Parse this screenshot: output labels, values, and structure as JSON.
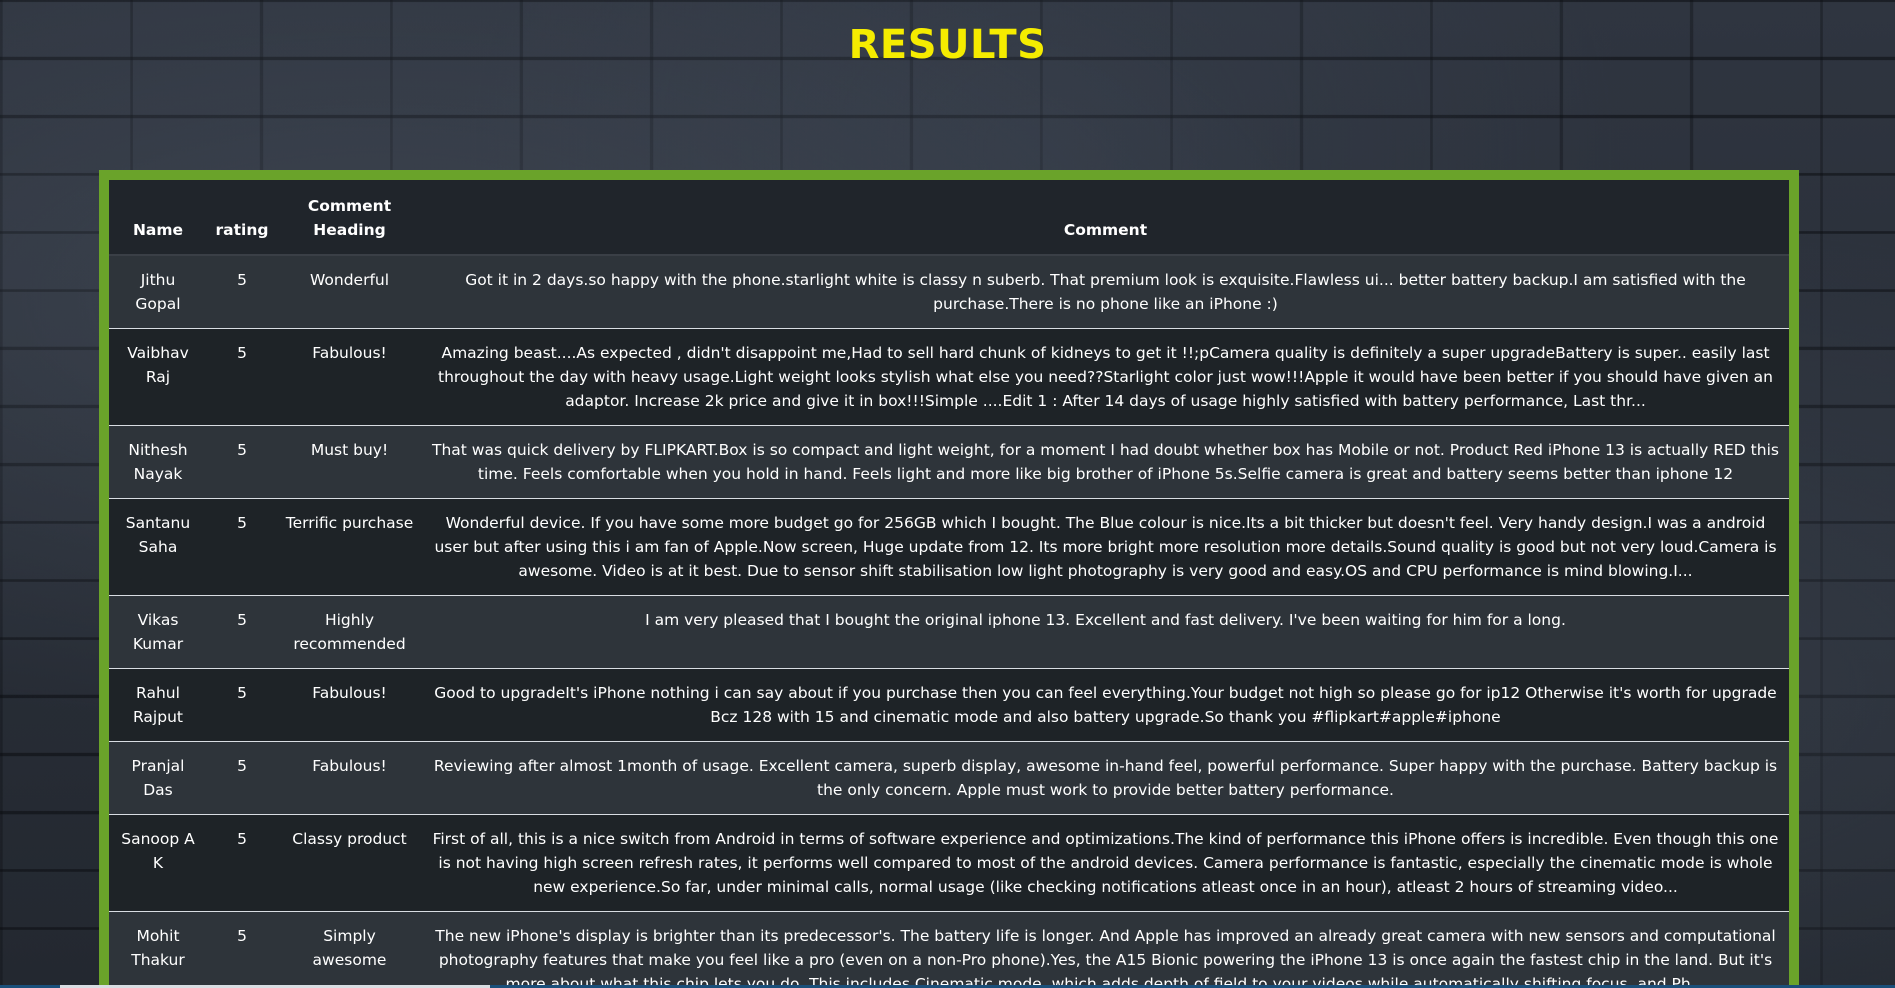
{
  "page": {
    "title": "RESULTS",
    "colors": {
      "title": "#f5ec00",
      "frame": "#6aa32a",
      "text": "#ffffff",
      "background": "#262c35"
    }
  },
  "table": {
    "headers": {
      "name": "Name",
      "rating": "rating",
      "heading": "Comment Heading",
      "comment": "Comment"
    },
    "rows": [
      {
        "name": "Jithu Gopal",
        "rating": "5",
        "heading": "Wonderful",
        "comment": "Got it in 2 days.so happy with the phone.starlight white is classy n suberb. That premium look is exquisite.Flawless ui... better battery backup.I am satisfied with the purchase.There is no phone like an iPhone :)"
      },
      {
        "name": "Vaibhav Raj",
        "rating": "5",
        "heading": "Fabulous!",
        "comment": "Amazing beast....As expected , didn't disappoint me,Had to sell hard chunk of kidneys to get it !!;pCamera quality is definitely a super upgradeBattery is super.. easily last throughout the day with heavy usage.Light weight looks stylish what else you need??Starlight color just wow!!!Apple it would have been better if you should have given an adaptor. Increase 2k price and give it in box!!!Simple ....Edit 1 : After 14 days of usage highly satisfied with battery performance, Last thr..."
      },
      {
        "name": "Nithesh Nayak",
        "rating": "5",
        "heading": "Must buy!",
        "comment": "That was quick delivery by FLIPKART.Box is so compact and light weight, for a moment I had doubt whether box has Mobile or not. Product Red iPhone 13 is actually RED this time. Feels comfortable when you hold in hand. Feels light and more like big brother of iPhone 5s.Selfie camera is great and battery seems better than iphone 12"
      },
      {
        "name": "Santanu Saha",
        "rating": "5",
        "heading": "Terrific purchase",
        "comment": "Wonderful device. If you have some more budget go for 256GB which I bought. The Blue colour is nice.Its a bit thicker but doesn't feel. Very handy design.I was a android user but after using this i am fan of Apple.Now screen, Huge update from 12. Its more bright more resolution more details.Sound quality is good but not very loud.Camera is awesome. Video is at it best. Due to sensor shift stabilisation low light photography is very good and easy.OS and CPU performance is mind blowing.I..."
      },
      {
        "name": "Vikas Kumar",
        "rating": "5",
        "heading": "Highly recommended",
        "comment": "I am very pleased that I bought the original iphone 13. Excellent and fast delivery. I've been waiting for him for a long."
      },
      {
        "name": "Rahul Rajput",
        "rating": "5",
        "heading": "Fabulous!",
        "comment": "Good to upgradeIt's iPhone nothing i can say about if you purchase then you can feel everything.Your budget not high so please go for ip12 Otherwise it's worth for upgrade Bcz 128 with 15 and cinematic mode and also battery upgrade.So thank you #flipkart#apple#iphone"
      },
      {
        "name": "Pranjal Das",
        "rating": "5",
        "heading": "Fabulous!",
        "comment": "Reviewing after almost 1month of usage. Excellent camera, superb display, awesome in-hand feel, powerful performance. Super happy with the purchase. Battery backup is the only concern. Apple must work to provide better battery performance."
      },
      {
        "name": "Sanoop A K",
        "rating": "5",
        "heading": "Classy product",
        "comment": "First of all, this is a nice switch from Android in terms of software experience and optimizations.The kind of performance this iPhone offers is incredible. Even though this one is not having high screen refresh rates, it performs well compared to most of the android devices. Camera performance is fantastic, especially the cinematic mode is whole new experience.So far, under minimal calls, normal usage (like checking notifications atleast once in an hour), atleast 2 hours of streaming video..."
      },
      {
        "name": "Mohit Thakur",
        "rating": "5",
        "heading": "Simply awesome",
        "comment": "The new iPhone's display is brighter than its predecessor's. The battery life is longer. And Apple has improved an already great camera with new sensors and computational photography features that make you feel like a pro (even on a non-Pro phone).Yes, the A15 Bionic powering the iPhone 13 is once again the fastest chip in the land. But it's more about what this chip lets you do. This includes Cinematic mode, which adds depth of field to your videos while automatically shifting focus, and Ph..."
      }
    ]
  }
}
